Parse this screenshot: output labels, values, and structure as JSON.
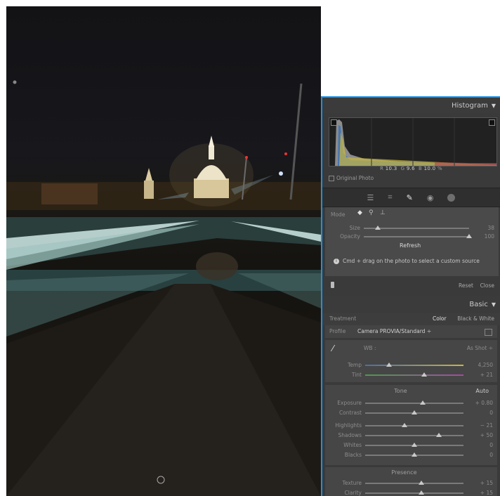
{
  "histogram": {
    "title": "Histogram",
    "readout": {
      "r_label": "R",
      "r": "10.3",
      "g_label": "G",
      "g": "9.6",
      "b_label": "B",
      "b": "10.0",
      "unit": "%"
    },
    "original_photo": "Original Photo"
  },
  "tools": [
    "sliders-icon",
    "crop-icon",
    "heal-brush-icon",
    "red-eye-icon",
    "mask-icon"
  ],
  "heal": {
    "mode_label": "Mode",
    "size_label": "Size",
    "size_value": "38",
    "size_level": 0.15,
    "opacity_label": "Opacity",
    "opacity_value": "100",
    "opacity_level": 1.0,
    "refresh": "Refresh",
    "info": "Cmd + drag on the photo to select a custom source",
    "reset": "Reset",
    "close": "Close"
  },
  "basic": {
    "title": "Basic",
    "treatment_label": "Treatment",
    "treatment_color": "Color",
    "treatment_bw": "Black & White",
    "profile_label": "Profile",
    "profile_value": "Camera PROVIA/Standard ÷",
    "wb_label": "WB :",
    "wb_value": "As Shot ÷",
    "temp_label": "Temp",
    "temp_value": "4,250",
    "tint_label": "Tint",
    "tint_value": "+ 21",
    "tone_title": "Tone",
    "auto": "Auto",
    "exposure_label": "Exposure",
    "exposure_value": "+ 0.80",
    "contrast_label": "Contrast",
    "contrast_value": "0",
    "highlights_label": "Highlights",
    "highlights_value": "− 21",
    "shadows_label": "Shadows",
    "shadows_value": "+ 50",
    "whites_label": "Whites",
    "whites_value": "0",
    "blacks_label": "Blacks",
    "blacks_value": "0",
    "presence_title": "Presence",
    "texture_label": "Texture",
    "texture_value": "+ 15",
    "clarity_label": "Clarity",
    "clarity_value": "+ 15"
  },
  "colors": {
    "accent": "#1f8fe0",
    "panel": "#3a3a3a"
  }
}
